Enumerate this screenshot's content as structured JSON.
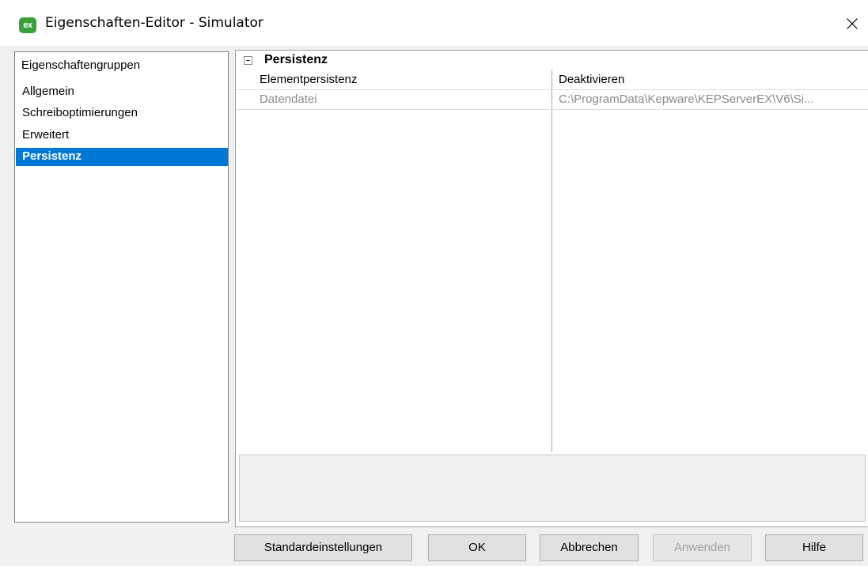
{
  "window": {
    "title": "Eigenschaften-Editor - Simulator",
    "app_icon_text": "ex",
    "close_icon": "close-icon"
  },
  "groups": {
    "header": "Eigenschaftengruppen",
    "items": [
      {
        "label": "Allgemein",
        "selected": false
      },
      {
        "label": "Schreiboptimierungen",
        "selected": false
      },
      {
        "label": "Erweitert",
        "selected": false
      },
      {
        "label": "Persistenz",
        "selected": true
      }
    ]
  },
  "properties": {
    "category": "Persistenz",
    "expander_icon": "collapse-icon",
    "rows": [
      {
        "name": "Elementpersistenz",
        "value": "Deaktivieren",
        "disabled": false
      },
      {
        "name": "Datendatei",
        "value": "C:\\ProgramData\\Kepware\\KEPServerEX\\V6\\Si...",
        "disabled": true
      }
    ]
  },
  "buttons": {
    "defaults": "Standardeinstellungen",
    "ok": "OK",
    "cancel": "Abbrechen",
    "apply": "Anwenden",
    "help": "Hilfe"
  },
  "colors": {
    "selection": "#0078d7",
    "app_icon": "#3aa13a"
  }
}
